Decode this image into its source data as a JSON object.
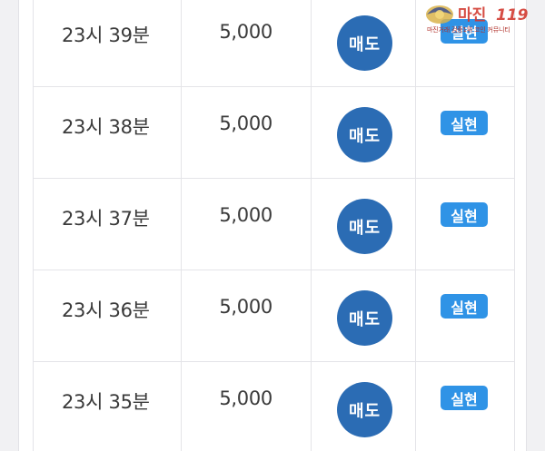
{
  "rows": [
    {
      "time": "23시 39분",
      "amount": "5,000",
      "action": "매도",
      "result": "실현"
    },
    {
      "time": "23시 38분",
      "amount": "5,000",
      "action": "매도",
      "result": "실현"
    },
    {
      "time": "23시 37분",
      "amount": "5,000",
      "action": "매도",
      "result": "실현"
    },
    {
      "time": "23시 36분",
      "amount": "5,000",
      "action": "매도",
      "result": "실현"
    },
    {
      "time": "23시 35분",
      "amount": "5,000",
      "action": "매도",
      "result": "실현"
    }
  ],
  "watermark": {
    "logo": "마진 119",
    "tagline": "마진거래 검증1위 코인 커뮤니티"
  },
  "colors": {
    "sell_button": "#2b6cb4",
    "result_badge": "#2f93e6",
    "watermark_red": "#d23a30"
  }
}
